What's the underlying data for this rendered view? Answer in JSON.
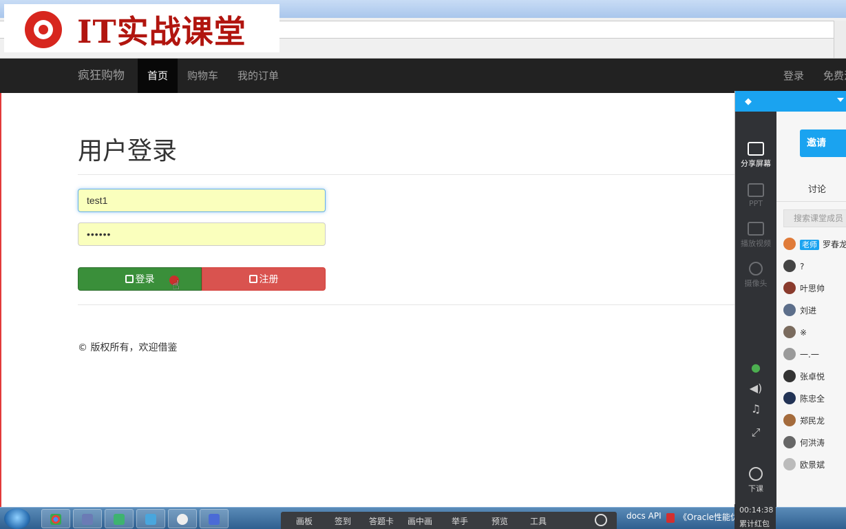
{
  "logo": {
    "text": "IT实战课堂"
  },
  "navbar": {
    "brand": "疯狂购物",
    "items": [
      {
        "label": "首页",
        "active": true
      },
      {
        "label": "购物车",
        "active": false
      },
      {
        "label": "我的订单",
        "active": false
      }
    ],
    "right": {
      "login": "登录",
      "register": "免费注册"
    }
  },
  "login_form": {
    "title": "用户登录",
    "username_value": "test1",
    "password_value": "••••••",
    "login_button": "登录",
    "register_button": "注册"
  },
  "footer": {
    "copyright": "© 版权所有，欢迎借鉴"
  },
  "classroom_panel": {
    "tools": [
      {
        "label": "分享屏幕",
        "active": true
      },
      {
        "label": "PPT",
        "active": false
      },
      {
        "label": "播放视频",
        "active": false
      },
      {
        "label": "摄像头",
        "active": false
      }
    ],
    "end_class": "下课",
    "invite_button": "邀请",
    "tab": "讨论",
    "search_placeholder": "搜索课堂成员",
    "teacher_badge": "老师",
    "members": [
      {
        "name": "罗春龙",
        "color": "#e07b39"
      },
      {
        "name": "?",
        "color": "#444444"
      },
      {
        "name": "叶思帅",
        "color": "#8a3b2d"
      },
      {
        "name": "刘进",
        "color": "#5c6e8a"
      },
      {
        "name": "※",
        "color": "#7a6b5e"
      },
      {
        "name": "一.一",
        "color": "#9a9a9a"
      },
      {
        "name": "张卓悦",
        "color": "#333333"
      },
      {
        "name": "陈忠全",
        "color": "#223355"
      },
      {
        "name": "郑民龙",
        "color": "#a46b3c"
      },
      {
        "name": "何洪涛",
        "color": "#666666"
      },
      {
        "name": "欧景斌",
        "color": "#bbbbbb"
      }
    ],
    "timer": "00:14:38",
    "red_packet": "累计红包"
  },
  "classroom_toolbar": [
    "画板",
    "签到",
    "答题卡",
    "画中画",
    "举手",
    "预览",
    "工具"
  ],
  "taskbar": {
    "docs_label": "docs API",
    "oracle_label": "《Oracle性能优化"
  },
  "colors": {
    "navbar_bg": "#222222",
    "login_green": "#3a8f3a",
    "register_red": "#d9534f",
    "panel_blue": "#1aa3f0"
  }
}
